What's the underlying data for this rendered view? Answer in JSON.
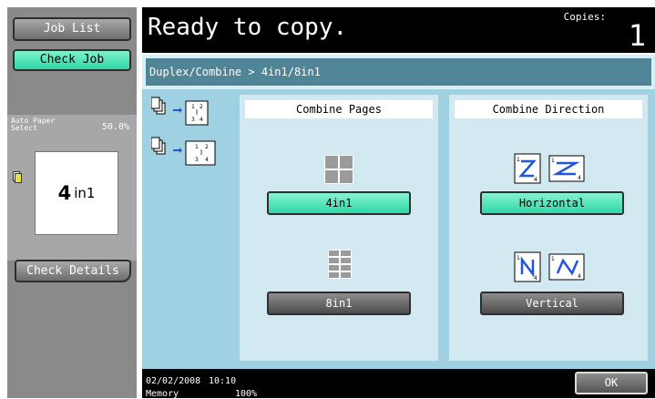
{
  "left_rail": {
    "job_list_label": "Job List",
    "check_job_label": "Check Job",
    "paper_select_line1": "Auto Paper",
    "paper_select_line2": "Select",
    "zoom_value": "50.0%",
    "layout_big": "4",
    "layout_small": "in1",
    "check_details_label": "Check Details"
  },
  "header": {
    "status": "Ready to copy.",
    "copies_label": "Copies:",
    "copies_value": "1"
  },
  "breadcrumb": "Duplex/Combine > 4in1/8in1",
  "combine_pages": {
    "title": "Combine Pages",
    "options": [
      "4in1",
      "8in1"
    ],
    "selected": "4in1"
  },
  "combine_direction": {
    "title": "Combine Direction",
    "options": [
      "Horizontal",
      "Vertical"
    ],
    "selected": "Horizontal"
  },
  "footer": {
    "date": "02/02/2008",
    "time": "10:10",
    "memory_label": "Memory",
    "memory_value": "100%",
    "ok_label": "OK"
  },
  "colors": {
    "selected_green": "#2fd8a8",
    "breadcrumb_bar": "#4f8597",
    "content_bg": "#9fd1e3"
  },
  "icons": [
    "combine-example-icon",
    "grid-4-icon",
    "grid-8-icon",
    "horizontal-direction-icon",
    "vertical-direction-icon"
  ]
}
